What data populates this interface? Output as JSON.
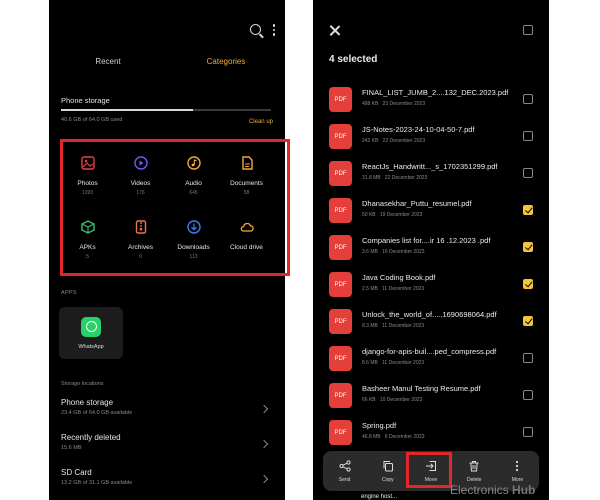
{
  "left": {
    "tabs": [
      {
        "label": "Recent",
        "active": false
      },
      {
        "label": "Categories",
        "active": true
      }
    ],
    "storage": {
      "title": "Phone storage",
      "used_text": "40.6 GB of 64.0 GB used",
      "fill_fraction": 0.63,
      "cleanup_label": "Clean up"
    },
    "categories": [
      {
        "label": "Photos",
        "count": "1393",
        "icon": "photos-icon",
        "color": "#e8424a"
      },
      {
        "label": "Videos",
        "count": "176",
        "icon": "videos-icon",
        "color": "#6a5cf5"
      },
      {
        "label": "Audio",
        "count": "645",
        "icon": "audio-icon",
        "color": "#f2a93b"
      },
      {
        "label": "Documents",
        "count": "58",
        "icon": "documents-icon",
        "color": "#f2a93b"
      },
      {
        "label": "APKs",
        "count": "5",
        "icon": "apks-icon",
        "color": "#3dbf6e"
      },
      {
        "label": "Archives",
        "count": "0",
        "icon": "archives-icon",
        "color": "#e8764a"
      },
      {
        "label": "Downloads",
        "count": "113",
        "icon": "downloads-icon",
        "color": "#3a7ff5"
      },
      {
        "label": "Cloud drive",
        "count": "",
        "icon": "cloud-drive-icon",
        "color": "#f2a93b"
      }
    ],
    "apps_label": "APPS",
    "apps": [
      {
        "label": "WhatsApp",
        "icon": "whatsapp-icon"
      }
    ],
    "locations_label": "Storage locations",
    "locations": [
      {
        "title": "Phone storage",
        "sub": "23.4 GB of 64.0 GB available"
      },
      {
        "title": "Recently deleted",
        "sub": "15.6 MB"
      },
      {
        "title": "SD Card",
        "sub": "13.2 GB of 31.1 GB available"
      }
    ]
  },
  "right": {
    "selected_count": "4 selected",
    "files": [
      {
        "name": "FINAL_LIST_JUMB_2....132_DEC.2023.pdf",
        "size": "488 KB",
        "date": "23 December 2023",
        "checked": false
      },
      {
        "name": "JS-Notes-2023-24-10-04-50-7.pdf",
        "size": "242 KB",
        "date": "22 December 2023",
        "checked": false
      },
      {
        "name": "ReactJs_Handwritt..._s_1702351299.pdf",
        "size": "31.8 MB",
        "date": "22 December 2023",
        "checked": false
      },
      {
        "name": "Dhanasekhar_Puttu_resumel.pdf",
        "size": "50 KB",
        "date": "19 December 2023",
        "checked": true
      },
      {
        "name": "Companies list for....ir 16 .12.2023 .pdf",
        "size": "3.6 MB",
        "date": "16 December 2023",
        "checked": true
      },
      {
        "name": "Java Coding Book.pdf",
        "size": "2.5 MB",
        "date": "11 December 2023",
        "checked": true
      },
      {
        "name": "Unlock_the_world_of.....1690698064.pdf",
        "size": "8.3 MB",
        "date": "11 December 2023",
        "checked": true
      },
      {
        "name": "django-for-apis-buil....ped_compress.pdf",
        "size": "8.6 MB",
        "date": "11 December 2023",
        "checked": false
      },
      {
        "name": "Basheer Manul Testing Resume.pdf",
        "size": "66 KB",
        "date": "10 December 2023",
        "checked": false
      },
      {
        "name": "Spring.pdf",
        "size": "46.8 MB",
        "date": "6 December 2023",
        "checked": false
      }
    ],
    "file_icon_label": "PDF",
    "peek_text": "engine host...",
    "actions": [
      {
        "label": "Send",
        "icon": "share-icon"
      },
      {
        "label": "Copy",
        "icon": "copy-icon"
      },
      {
        "label": "Move",
        "icon": "move-icon"
      },
      {
        "label": "Delete",
        "icon": "delete-icon"
      },
      {
        "label": "More",
        "icon": "more-icon"
      }
    ]
  },
  "watermark": {
    "prefix": "Electronics",
    "strong": "Hub"
  },
  "colors": {
    "accent": "#f2a93b",
    "highlight": "#e1272c",
    "pdf": "#e43f3a",
    "check": "#f2c53b"
  }
}
